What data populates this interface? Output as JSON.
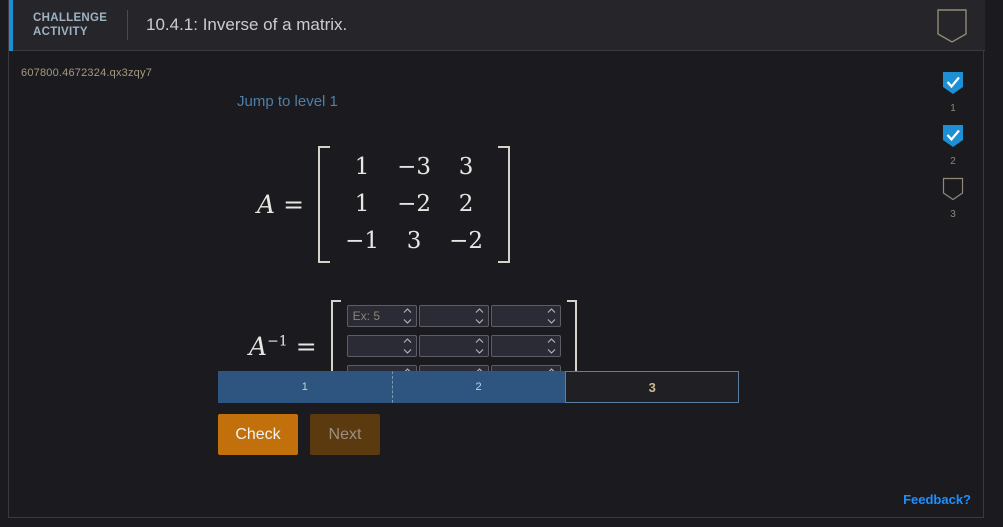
{
  "header": {
    "kicker": "CHALLENGE ACTIVITY",
    "kicker_line1": "CHALLENGE",
    "kicker_line2": "ACTIVITY",
    "title": "10.4.1: Inverse of a matrix.",
    "badge_icon": "shield-outline-icon",
    "accent_color": "#1f8fd4",
    "background": "#26262a"
  },
  "activity": {
    "id": "607800.4672324.qx3zqy7",
    "jump_link": "Jump to level 1"
  },
  "matrix_a": {
    "label": "A",
    "equals": "=",
    "rows": [
      [
        "1",
        "−3",
        "3"
      ],
      [
        "1",
        "−2",
        "2"
      ],
      [
        "−1",
        "3",
        "−2"
      ]
    ]
  },
  "matrix_inverse": {
    "label": "A",
    "exponent": "−1",
    "equals": "=",
    "cells": [
      [
        {
          "value": "",
          "placeholder": "Ex: 5"
        },
        {
          "value": "",
          "placeholder": ""
        },
        {
          "value": "",
          "placeholder": ""
        }
      ],
      [
        {
          "value": "",
          "placeholder": ""
        },
        {
          "value": "",
          "placeholder": ""
        },
        {
          "value": "",
          "placeholder": ""
        }
      ],
      [
        {
          "value": "",
          "placeholder": ""
        },
        {
          "value": "",
          "placeholder": ""
        },
        {
          "value": "",
          "placeholder": ""
        }
      ]
    ],
    "spinner_icon": "up-down-chevron-icon"
  },
  "progress": {
    "segments": [
      {
        "label": "1",
        "state": "done"
      },
      {
        "label": "2",
        "state": "done"
      },
      {
        "label": "3",
        "state": "current"
      }
    ],
    "done_color": "#2e5580",
    "current_border_color": "#5d7ea3"
  },
  "buttons": {
    "check": "Check",
    "next": "Next",
    "check_color": "#c2700c",
    "next_color": "#5c3a10"
  },
  "feedback": {
    "label": "Feedback?",
    "color": "#1f8fff"
  },
  "rail": {
    "items": [
      {
        "label": "1",
        "state": "complete",
        "icon": "shield-check-icon"
      },
      {
        "label": "2",
        "state": "complete",
        "icon": "shield-check-icon"
      },
      {
        "label": "3",
        "state": "empty",
        "icon": "shield-outline-icon"
      }
    ],
    "complete_color": "#1f8fd4"
  }
}
